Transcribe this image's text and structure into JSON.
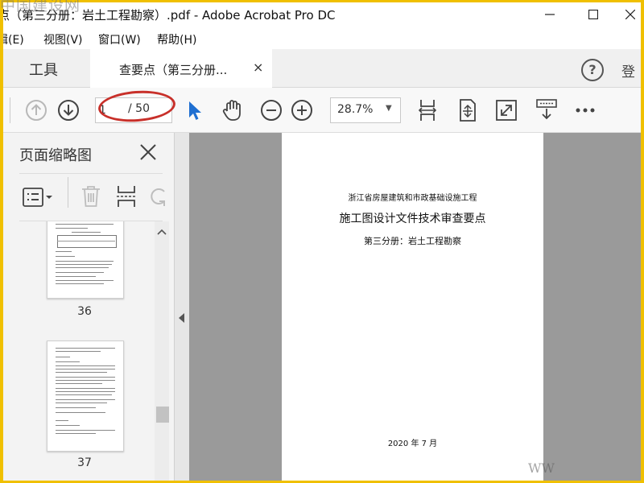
{
  "window": {
    "title": "要点（第三分册：岩土工程勘察）.pdf - Adobe Acrobat Pro DC"
  },
  "menu": {
    "items": [
      {
        "label": "编辑(E)"
      },
      {
        "label": "视图(V)"
      },
      {
        "label": "窗口(W)"
      },
      {
        "label": "帮助(H)"
      }
    ]
  },
  "tabs": {
    "tools_label": "工具",
    "doc_tab_label": "查要点（第三分册...",
    "close_glyph": "×",
    "help_glyph": "?",
    "login_label": "登"
  },
  "toolbar": {
    "page_current": "1",
    "page_total": "/ 50",
    "zoom": "28.7%",
    "zoom_arrow": "▼",
    "highlight_color": "#c8302a",
    "icons": [
      "prev-page-icon",
      "next-page-icon",
      "select-arrow-icon",
      "hand-tool-icon",
      "zoom-out-icon",
      "zoom-in-icon",
      "fit-width-icon",
      "fit-page-icon",
      "full-screen-icon",
      "scroll-mode-icon",
      "more-icon"
    ]
  },
  "panel": {
    "title": "页面缩略图",
    "thumbnails": [
      {
        "page_number": "36"
      },
      {
        "page_number": "37"
      }
    ]
  },
  "document": {
    "line1": "浙江省房屋建筑和市政基础设施工程",
    "line2": "施工图设计文件技术审查要点",
    "line3": "第三分册：岩土工程勘察",
    "date": "2020 年 7 月"
  },
  "watermarks": {
    "top": "中国建设网",
    "bottom": "WW"
  },
  "colors": {
    "frame": "#f0c000",
    "select_tool_blue": "#1f6fd1"
  }
}
